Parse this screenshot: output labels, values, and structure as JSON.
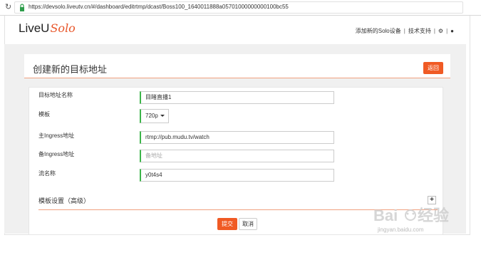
{
  "browser": {
    "url": "https://devsolo.liveutv.cn/#/dashboard/editrtmp/dcast/Boss100_1640011888a05701000000000100bc55"
  },
  "brand": {
    "live_u": "LiveU",
    "solo": "Solo"
  },
  "topnav": {
    "add_device": "添加新的Solo设备",
    "support": "技术支持"
  },
  "header": {
    "title": "创建新的目标地址",
    "back_label": "返回"
  },
  "form": {
    "fields": [
      {
        "label": "目标地址名称",
        "value": "目睹直播1",
        "placeholder": ""
      },
      {
        "label": "模板",
        "value": "720p",
        "placeholder": ""
      },
      {
        "label": "主Ingress地址",
        "value": "rtmp://pub.mudu.tv/watch",
        "placeholder": ""
      },
      {
        "label": "备Ingress地址",
        "value": "",
        "placeholder": "备地址"
      },
      {
        "label": "流名称",
        "value": "y0t4s4",
        "placeholder": ""
      }
    ],
    "advanced_label": "模板设置（高级）",
    "submit_label": "提交",
    "cancel_label": "取消"
  },
  "watermark": {
    "text": "jingyan.baidu.com"
  },
  "colors": {
    "accent": "#f05a24",
    "field_valid": "#3cb54a"
  }
}
